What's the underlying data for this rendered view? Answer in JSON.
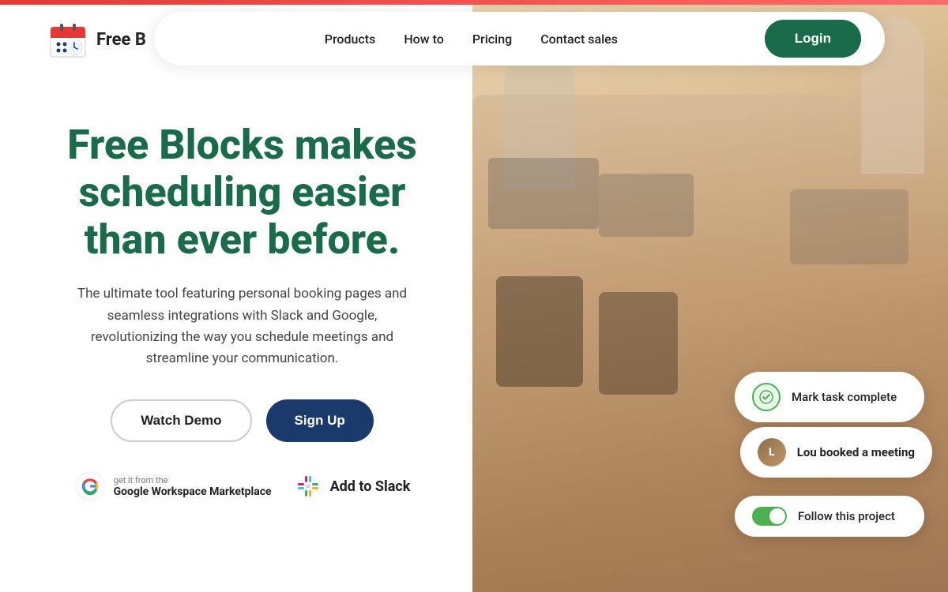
{
  "topBar": {},
  "logo": {
    "text": "Free B",
    "alt": "Free Blocks Logo"
  },
  "nav": {
    "links": [
      {
        "id": "products",
        "label": "Products"
      },
      {
        "id": "howto",
        "label": "How to"
      },
      {
        "id": "pricing",
        "label": "Pricing"
      },
      {
        "id": "contact",
        "label": "Contact sales"
      }
    ],
    "login_label": "Login"
  },
  "hero": {
    "title_line1": "Free Blocks makes",
    "title_line2": "scheduling easier",
    "title_line3": "than ever before.",
    "subtitle": "The ultimate tool featuring personal booking pages and seamless integrations with Slack and Google, revolutionizing the way you schedule meetings and streamline your communication.",
    "btn_watch": "Watch Demo",
    "btn_signup": "Sign Up",
    "integration_google_small": "get it from the",
    "integration_google_name": "Google Workspace Marketplace",
    "integration_slack_name": "Add to Slack"
  },
  "notifications": {
    "mark_task": "Mark task complete",
    "booked_prefix": "Lou",
    "booked_suffix": " booked a meeting",
    "follow_project": "Follow this project"
  },
  "colors": {
    "primary_green": "#1a6b4a",
    "primary_dark_blue": "#1a3a6b",
    "check_green": "#4caf50"
  }
}
